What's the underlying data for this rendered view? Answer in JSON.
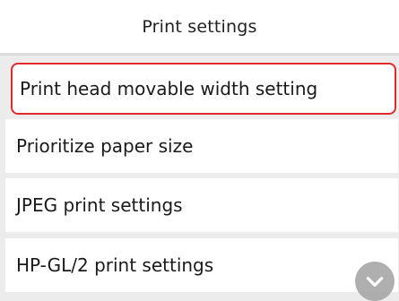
{
  "header": {
    "title": "Print settings"
  },
  "menu": {
    "items": [
      {
        "label": "Print head movable width setting",
        "selected": true
      },
      {
        "label": "Prioritize paper size",
        "selected": false
      },
      {
        "label": "JPEG print settings",
        "selected": false
      },
      {
        "label": "HP-GL/2 print settings",
        "selected": false
      }
    ]
  },
  "controls": {
    "scroll_icon": "chevron-down-icon"
  },
  "colors": {
    "selection_border": "#e12b2b",
    "background": "#ececec",
    "row_background": "#ffffff",
    "scroll_button": "#a7a7a7"
  }
}
